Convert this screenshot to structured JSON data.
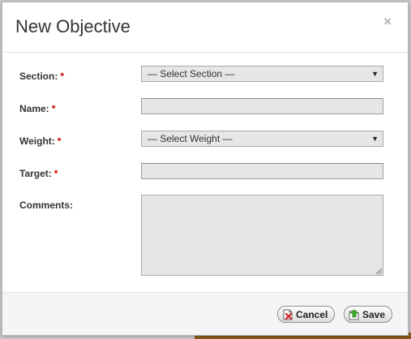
{
  "dialog": {
    "title": "New Objective",
    "close_glyph": "×"
  },
  "form": {
    "section": {
      "label": "Section:",
      "required_mark": "*",
      "selected": "— Select Section —"
    },
    "name": {
      "label": "Name:",
      "required_mark": "*",
      "value": ""
    },
    "weight": {
      "label": "Weight:",
      "required_mark": "*",
      "selected": "— Select Weight —"
    },
    "target": {
      "label": "Target:",
      "required_mark": "*",
      "value": ""
    },
    "comments": {
      "label": "Comments:",
      "value": ""
    }
  },
  "footer": {
    "cancel_label": "Cancel",
    "save_label": "Save"
  },
  "icons": {
    "close": "close-icon",
    "cancel": "cancel-document-icon",
    "save": "save-document-icon",
    "dropdown": "dropdown-arrow-icon"
  },
  "colors": {
    "required": "#cc0000",
    "title": "#333333",
    "field_background": "#e6e6e6"
  }
}
